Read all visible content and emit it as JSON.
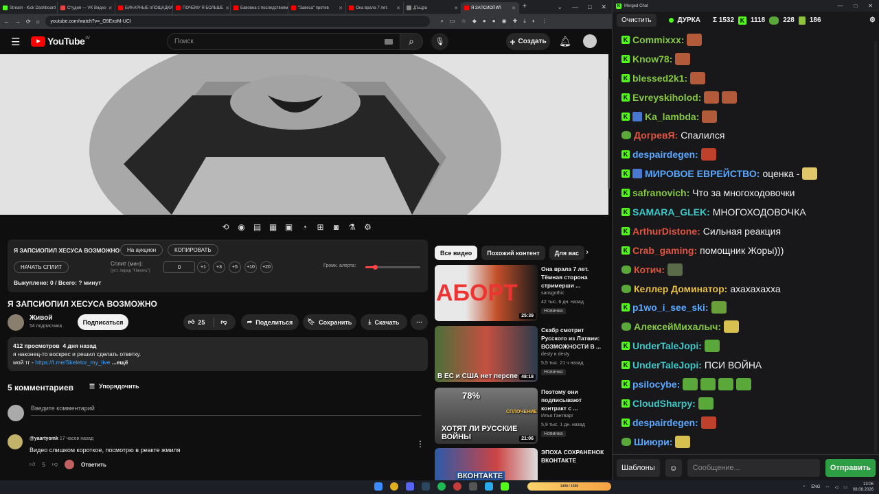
{
  "browser": {
    "tabs": [
      {
        "label": "Stream - Kick Dashboard",
        "color": "#53fc18"
      },
      {
        "label": "Студия — VK Видео",
        "color": "#e64646"
      },
      {
        "label": "БИНАРНЫЕ пЛОЩАДКИ",
        "color": "#ff0000"
      },
      {
        "label": "ПОЧЕМУ Я БОЛЬШЕ",
        "color": "#ff0000"
      },
      {
        "label": "Бавовна с последствиями",
        "color": "#ff0000"
      },
      {
        "label": "\"Завеса\" против",
        "color": "#ff0000"
      },
      {
        "label": "Она врала 7 лет.",
        "color": "#ff0000"
      },
      {
        "label": "ДЪЦра",
        "color": "#888888"
      },
      {
        "label": "Я ЗАПСИОПИЛ",
        "color": "#ff0000",
        "active": true
      }
    ],
    "new_tab": "+",
    "url": "youtube.com/watch?v=_O9ExoM-UCI"
  },
  "youtube": {
    "logo": "YouTube",
    "region": "LV",
    "search_placeholder": "Поиск",
    "create_label": "Создать"
  },
  "plugin": {
    "title": "Я ЗАПСИОПИЛ ХЕСУСА ВОЗМОЖНО",
    "auction_btn": "На аукцион",
    "copy_btn": "КОПИРОВАТЬ",
    "start_split_btn": "НАЧАТЬ СПЛИТ",
    "split_label": "Сплит (мин):",
    "split_hint": "(уст. перед \"Начать\")",
    "split_value": "0",
    "steps": [
      "+1",
      "+3",
      "+5",
      "+10",
      "+20"
    ],
    "volume_label": "Громк. алерта:",
    "volume_level": 0.17,
    "paid_text": "Выкуплено: 0 / Всего: ? минут"
  },
  "video": {
    "title": "Я ЗАПСИОПИЛ ХЕСУСА ВОЗМОЖНО",
    "channel": "Живой",
    "subs": "54 подписчика",
    "subscribe_label": "Подписаться",
    "likes": "25",
    "share_label": "Поделиться",
    "save_label": "Сохранить",
    "download_label": "Скачать",
    "views": "412 просмотров",
    "date": "4 дня назад",
    "description": "я наконец-то воскрес и решил сделать ответку.",
    "desc_prefix": "мой тг - ",
    "desc_link": "https://t.me/Skeletor_my_live",
    "desc_more": "...ещё"
  },
  "comments": {
    "count_label": "5 комментариев",
    "sort_label": "Упорядочить",
    "input_placeholder": "Введите комментарий",
    "first": {
      "author": "@yaartyomk",
      "time": "17 часов назад",
      "text": "Видео слишком короткое, посмотрю в реакте жмиля",
      "likes": "5",
      "reply_label": "Ответить"
    }
  },
  "chips": [
    "Все видео",
    "Похожий контент",
    "Для вас"
  ],
  "recommendations": [
    {
      "title": "Она врала 7 лет. Тёмная сторона стримерши ...",
      "channel": "sansgothic",
      "meta": "42 тыс.   6 дн. назад",
      "badge": "Новинка",
      "duration": "25:39",
      "thumb_text": "АБОРТ"
    },
    {
      "title": "Скабр смотрит Русского из Латвии: ВОЗМОЖНОСТИ В ...",
      "channel": "desty и desty",
      "meta": "5,5 тыс.   21 ч назад",
      "badge": "Новинка",
      "duration": "48:18",
      "thumb_text": "В ЕС и США  нет перспе"
    },
    {
      "title": "Поэтому они подписывают контракт с ...",
      "channel": "Илья Гантварг",
      "meta": "5,9 тыс.   1 дн. назад",
      "badge": "Новинка",
      "duration": "21:06",
      "thumb_text": "ХОТЯТ ЛИ РУССКИЕ ВОЙНЫ",
      "thumb_text2": "78%",
      "thumb_text3": "СПЛОЧЕНИЕ"
    },
    {
      "title": "ЭПОХА СОХРАНЕНОК ВКОНТАКТЕ",
      "channel": "",
      "meta": "",
      "badge": "",
      "duration": "",
      "thumb_text": "ВКОНТАКТЕ"
    }
  ],
  "chat": {
    "window_title": "Merged Chat",
    "clear_label": "Очистить",
    "streamer": "ДУРКА",
    "total": "Σ 1532",
    "kick_count": "1118",
    "frog_count": "228",
    "other_count": "186",
    "messages": [
      {
        "platform": "kick",
        "user": "Commixxx:",
        "color": "#85c742",
        "text": "",
        "emotes": [
          "#b35a3a"
        ]
      },
      {
        "platform": "kick",
        "user": "Know78:",
        "color": "#85c742",
        "text": "",
        "emotes": [
          "#b35a3a"
        ]
      },
      {
        "platform": "kick",
        "user": "blessed2k1:",
        "color": "#85c742",
        "text": "",
        "emotes": [
          "#b35a3a"
        ]
      },
      {
        "platform": "kick",
        "user": "Evreyskiholod:",
        "color": "#85c742",
        "text": "",
        "emotes": [
          "#b35a3a",
          "#b35a3a"
        ]
      },
      {
        "platform": "kick",
        "user": "Ka_lambda:",
        "color": "#85c742",
        "text": "",
        "emotes": [
          "#b35a3a"
        ],
        "badge": true
      },
      {
        "platform": "frog",
        "user": "ДогревЯ:",
        "color": "#e05540",
        "text": "Спалился",
        "emotes": []
      },
      {
        "platform": "kick",
        "user": "despairdegen:",
        "color": "#5aa8ff",
        "text": "",
        "emotes": [
          "#c0412b"
        ]
      },
      {
        "platform": "kick",
        "user": "МИРОВОЕ ЕВРЕЙСТВО:",
        "color": "#5aa8ff",
        "text": "оценка -",
        "emotes": [
          "#e0c76a"
        ],
        "badge": true
      },
      {
        "platform": "kick",
        "user": "safranovich:",
        "color": "#85c742",
        "text": "Что за многоходовочки",
        "emotes": []
      },
      {
        "platform": "kick",
        "user": "SAMARA_GLEK:",
        "color": "#3ec7c7",
        "text": "МНОГОХОДОВОЧКА",
        "emotes": []
      },
      {
        "platform": "kick",
        "user": "ArthurDistone:",
        "color": "#e05540",
        "text": "Сильная реакция",
        "emotes": []
      },
      {
        "platform": "kick",
        "user": "Crab_gaming:",
        "color": "#e05540",
        "text": "помощник Жоры)))",
        "emotes": []
      },
      {
        "platform": "frog",
        "user": "Котич:",
        "color": "#e05540",
        "text": "",
        "emotes": [
          "#5a6b4a"
        ]
      },
      {
        "platform": "frog",
        "user": "Келлер Доминатор:",
        "color": "#e6c042",
        "text": "ахахахахха",
        "emotes": []
      },
      {
        "platform": "kick",
        "user": "p1wo_i_see_ski:",
        "color": "#5aa8ff",
        "text": "",
        "emotes": [
          "#6aa03a"
        ]
      },
      {
        "platform": "frog",
        "user": "АлексейМихалыч:",
        "color": "#85c742",
        "text": "",
        "emotes": [
          "#d8c050"
        ]
      },
      {
        "platform": "kick",
        "user": "UnderTaleJopi:",
        "color": "#3ec7c7",
        "text": "",
        "emotes": [
          "#5aa83a"
        ]
      },
      {
        "platform": "kick",
        "user": "UnderTaleJopi:",
        "color": "#3ec7c7",
        "text": "ПСИ ВОЙНА",
        "emotes": []
      },
      {
        "platform": "kick",
        "user": "psilocybe:",
        "color": "#5aa8ff",
        "text": "",
        "emotes": [
          "#5aa83a",
          "#5aa83a",
          "#5aa83a",
          "#5aa83a"
        ]
      },
      {
        "platform": "kick",
        "user": "CloudSharpy:",
        "color": "#3ec7c7",
        "text": "",
        "emotes": [
          "#5aa83a"
        ]
      },
      {
        "platform": "kick",
        "user": "despairdegen:",
        "color": "#5aa8ff",
        "text": "",
        "emotes": [
          "#c0412b"
        ]
      },
      {
        "platform": "frog",
        "user": "Шиюри:",
        "color": "#5aa8ff",
        "text": "",
        "emotes": [
          "#d8c050"
        ]
      }
    ],
    "templates_label": "Шаблоны",
    "input_placeholder": "Сообщение...",
    "send_label": "Отправить"
  },
  "taskbar": {
    "lang": "ENG",
    "time": "13:06",
    "date": "08.08.2026",
    "stream_widget": "1400 / 1500"
  }
}
